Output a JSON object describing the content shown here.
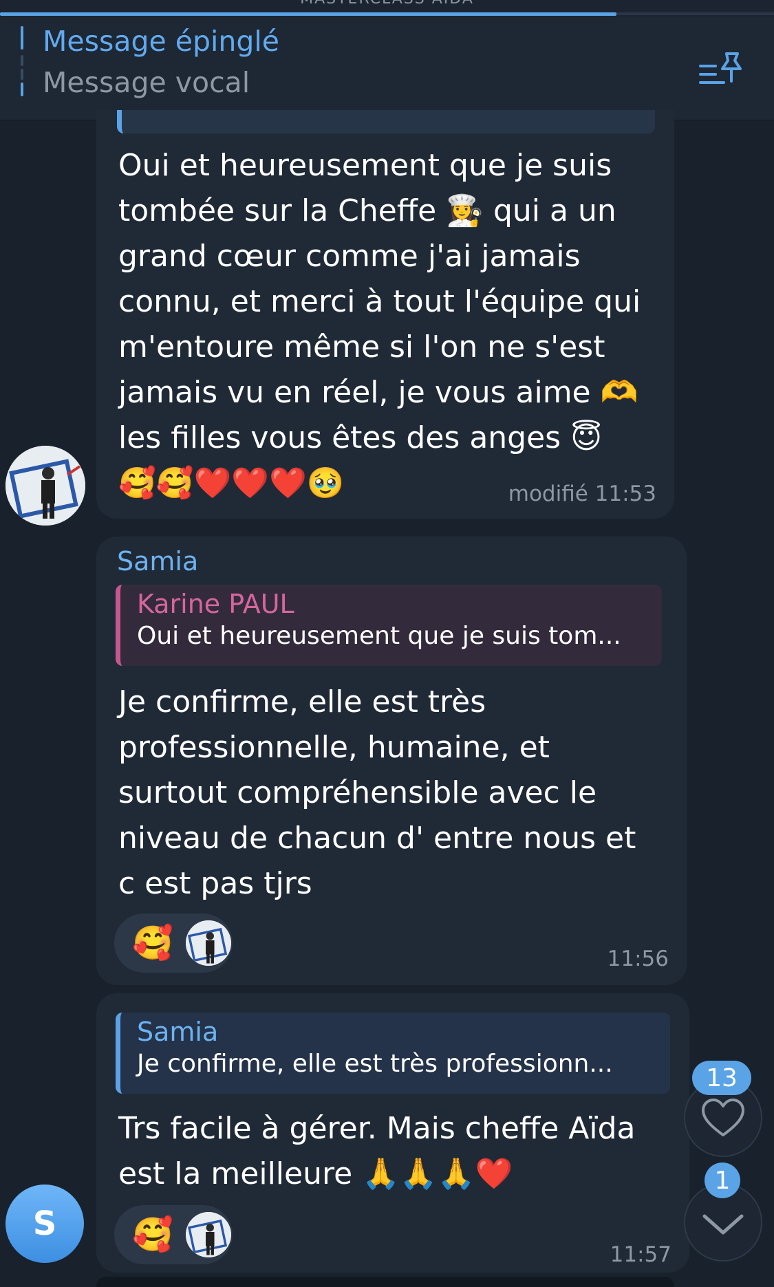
{
  "header": {
    "cut_title": "MASTERCLASS AIDA",
    "pinned_title": "Message épinglé",
    "pinned_subtitle": "Message vocal",
    "pinned_list_icon": "pinned-list-icon"
  },
  "messages": [
    {
      "lines": [
        "Oui et heureusement que je suis",
        "tombée sur la Cheffe 👩‍🍳 qui a un",
        "grand cœur comme j'ai jamais",
        "connu, et merci à tout l'équipe qui",
        "m'entoure même si l'on ne s'est",
        "jamais vu en réel, je vous aime 🫶",
        "les filles vous êtes des anges 😇",
        "🥰🥰❤️❤️❤️🥹"
      ],
      "time": "modifié 11:53"
    },
    {
      "sender": "Samia",
      "quote": {
        "name": "Karine PAUL",
        "text": "Oui et heureusement que je suis tom..."
      },
      "lines": [
        "Je confirme, elle est très",
        "professionnelle, humaine, et",
        "surtout compréhensible avec le",
        "niveau de chacun d' entre nous et",
        "c est pas tjrs"
      ],
      "reaction": "🥰",
      "time": "11:56"
    },
    {
      "quote": {
        "name": "Samia",
        "text": "Je confirme, elle est très professionn..."
      },
      "lines": [
        "Trs facile à gérer. Mais cheffe Aïda",
        "est la meilleure 🙏🙏🙏❤️"
      ],
      "reaction": "🥰",
      "time": "11:57"
    }
  ],
  "avatar_letter": "S",
  "floating": {
    "reactions_badge": "13",
    "unread_badge": "1"
  },
  "colors": {
    "background": "#19212c",
    "bubble": "#202a37",
    "accent": "#5aa3e6",
    "quote_pink": "#c7578f"
  }
}
